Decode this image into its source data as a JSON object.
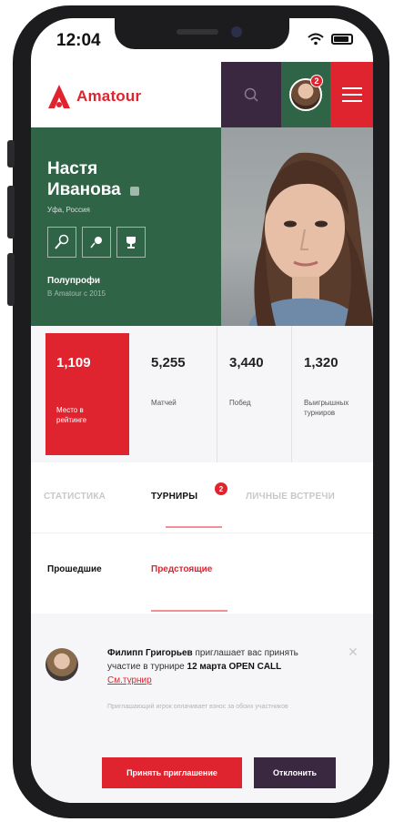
{
  "status_bar": {
    "time": "12:04"
  },
  "header": {
    "logo_text": "Amatour",
    "notification_count": "2",
    "icons": [
      "search-icon",
      "avatar",
      "menu-icon"
    ]
  },
  "profile": {
    "first_name": "Настя",
    "last_name": "Иванова",
    "city": "Уфа, Россия",
    "badges": [
      "racket-icon",
      "ball-icon",
      "trophy-icon"
    ],
    "level": "Полупрофи",
    "since": "В Amatour с 2015"
  },
  "stats": [
    {
      "value": "1,109",
      "label": "Место в рейтинге"
    },
    {
      "value": "5,255",
      "label": "Матчей"
    },
    {
      "value": "3,440",
      "label": "Побед"
    },
    {
      "value": "1,320",
      "label": "Выигрышных турниров"
    }
  ],
  "tabs": {
    "stats": "СТАТИСТИКА",
    "tournaments": "ТУРНИРЫ",
    "tournaments_badge": "2",
    "meetings": "ЛИЧНЫЕ ВСТРЕЧИ"
  },
  "subtabs": {
    "past": "Прошедшие",
    "upcoming": "Предстоящие"
  },
  "invitation": {
    "sender": "Филипп Григорьев",
    "text_1": " приглашает вас принять участие в турнире ",
    "date": "12 марта",
    "tournament": "OPEN CALL",
    "link": "См.турнир",
    "note": "Приглашающий игрок оплачивает взнос за обоих участников",
    "accept_label": "Принять приглашение",
    "decline_label": "Отклонить"
  },
  "colors": {
    "accent": "#e0242f",
    "green": "#2f6447",
    "plum": "#3a2740"
  }
}
